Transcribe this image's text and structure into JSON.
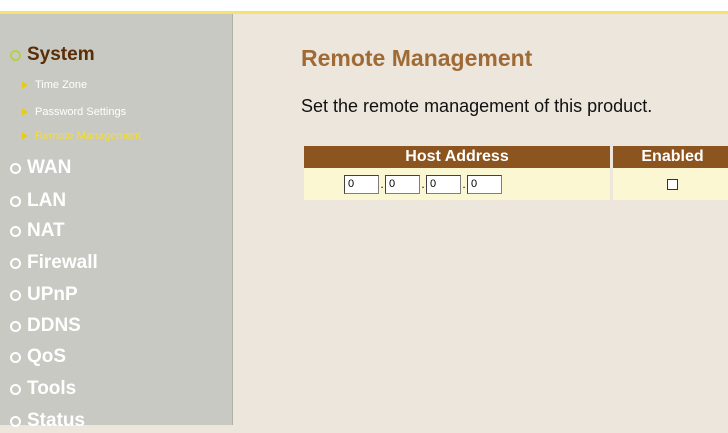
{
  "sidebar": {
    "menu": [
      {
        "label": "System",
        "active": true
      },
      {
        "label": "WAN"
      },
      {
        "label": "LAN"
      },
      {
        "label": "NAT"
      },
      {
        "label": "Firewall"
      },
      {
        "label": "UPnP"
      },
      {
        "label": "DDNS"
      },
      {
        "label": "QoS"
      },
      {
        "label": "Tools"
      },
      {
        "label": "Status"
      }
    ],
    "submenu": [
      {
        "label": "Time Zone"
      },
      {
        "label": "Password Settings"
      },
      {
        "label": "Remote Management",
        "current": true
      }
    ]
  },
  "main": {
    "title": "Remote Management",
    "description": "Set the remote management of this product.",
    "table": {
      "headers": [
        "Host Address",
        "Enabled"
      ],
      "host_octets": [
        "0",
        "0",
        "0",
        "0"
      ],
      "enabled": false
    }
  },
  "colors": {
    "accent_brown": "#8c541f",
    "title_brown": "#a06a35",
    "sidebar_bg": "#c7c9c2",
    "top_line": "#f5e36a",
    "current_sub": "#f5dc38"
  }
}
